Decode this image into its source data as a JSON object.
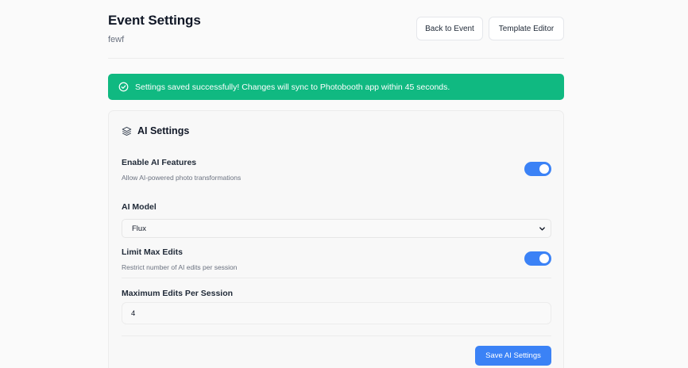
{
  "header": {
    "title": "Event Settings",
    "subtitle": "fewf",
    "back_label": "Back to Event",
    "template_label": "Template Editor"
  },
  "banner": {
    "message": "Settings saved successfully! Changes will sync to Photobooth app within 45 seconds.",
    "icon": "check-circle-icon",
    "color": "#10b981"
  },
  "ai_settings": {
    "title": "AI Settings",
    "icon": "layers-icon",
    "enable_ai": {
      "label": "Enable AI Features",
      "description": "Allow AI-powered photo transformations",
      "enabled": true
    },
    "model": {
      "label": "AI Model",
      "selected": "Flux"
    },
    "limit_edits": {
      "label": "Limit Max Edits",
      "description": "Restrict number of AI edits per session",
      "enabled": true
    },
    "max_edits": {
      "label": "Maximum Edits Per Session",
      "value": "4"
    },
    "save_label": "Save AI Settings"
  },
  "colors": {
    "accent": "#3b82f6",
    "success": "#10b981"
  }
}
